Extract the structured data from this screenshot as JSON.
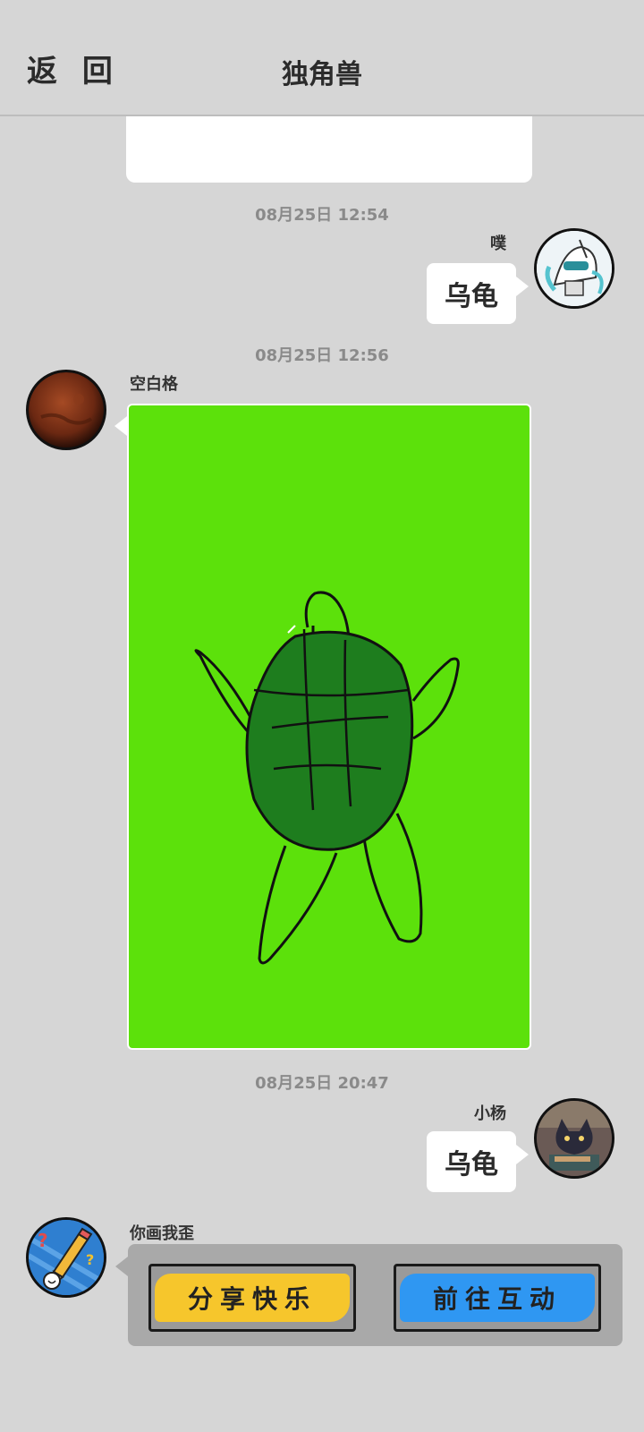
{
  "header": {
    "back_label": "返 回",
    "title": "独角兽"
  },
  "messages": [
    {
      "time": "08月25日  12:54",
      "sender": "噗",
      "text": "乌龟",
      "side": "right"
    },
    {
      "time": "08月25日  12:56",
      "sender": "空白格",
      "content": "turtle drawing",
      "side": "left"
    },
    {
      "time": "08月25日  20:47",
      "sender": "小杨",
      "text": "乌龟",
      "side": "right"
    }
  ],
  "game_card": {
    "sender": "你画我歪",
    "share_label": "分享快乐",
    "interact_label": "前往互动"
  },
  "colors": {
    "background": "#d6d6d6",
    "drawing_bg": "#5ce10b",
    "shell": "#1e7d1e",
    "share_fill": "#f6c62c",
    "interact_fill": "#2f97f2"
  }
}
